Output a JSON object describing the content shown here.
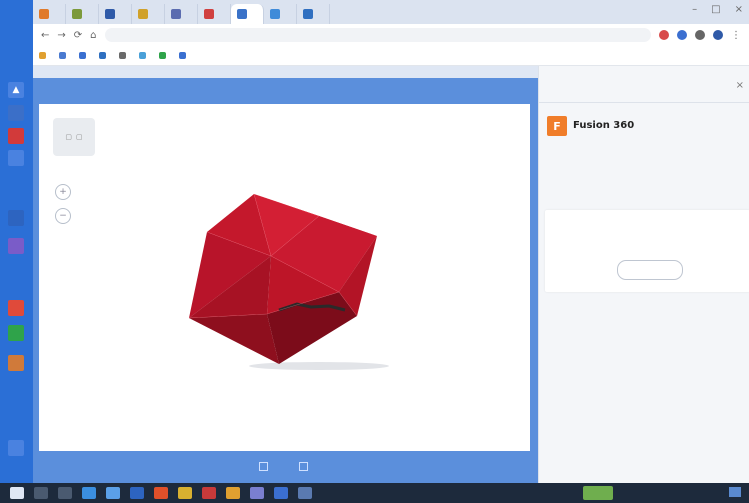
{
  "tabs": [
    {
      "label": "",
      "color": "#e07a2a"
    },
    {
      "label": "",
      "color": "#7c9a3a"
    },
    {
      "label": "",
      "color": "#2f5aa8"
    },
    {
      "label": "",
      "color": "#d0a12a"
    },
    {
      "label": "",
      "color": "#5b6cb0"
    },
    {
      "label": "",
      "color": "#d04040"
    },
    {
      "label": "",
      "color": "#3a72c8"
    },
    {
      "label": "",
      "color": "#3f8bd9"
    },
    {
      "label": "",
      "color": "#2f6fc0"
    }
  ],
  "address": {
    "url": ""
  },
  "bookmarks": [
    {
      "label": "",
      "color": "#e0a030"
    },
    {
      "label": "",
      "color": "#4a7ad0"
    },
    {
      "label": "",
      "color": "#3a6fd0"
    },
    {
      "label": "",
      "color": "#2f6fc0"
    },
    {
      "label": "",
      "color": "#6a6a6a"
    },
    {
      "label": "",
      "color": "#4aa0d8"
    },
    {
      "label": "",
      "color": "#2fa34a"
    },
    {
      "label": "",
      "color": "#3a6fd0"
    }
  ],
  "viewer": {
    "title": "",
    "zoom_in": "+",
    "zoom_out": "−",
    "footer_options": [
      {
        "label": ""
      },
      {
        "label": ""
      }
    ]
  },
  "right_panel": {
    "header": "",
    "close": "×",
    "app_logo": "F",
    "app_name": "Fusion 360",
    "description": "",
    "link": "",
    "card_text": "",
    "card_button": ""
  },
  "colors": {
    "viewer_blue": "#5b8fdc",
    "model_red": "#c5142a",
    "fusion_orange": "#f07d2a"
  }
}
